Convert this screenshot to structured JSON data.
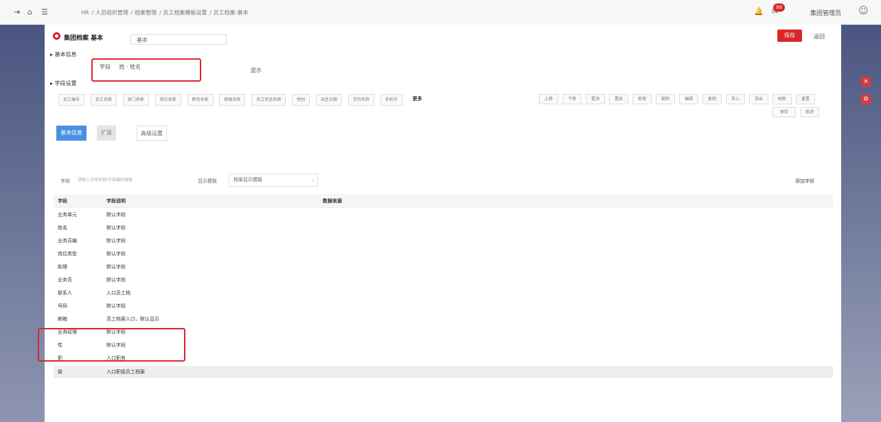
{
  "topbar": {
    "nav_icons": [
      "back-icon",
      "home-icon",
      "menu-icon"
    ],
    "breadcrumbs": [
      "HR",
      "人员组织管理",
      "档案管理",
      "员工档案模板设置",
      "员工档案-基本"
    ],
    "badge": "99",
    "user": "集团管理员",
    "colors": {
      "accent": "#d9262c",
      "primary": "#4a90e2"
    }
  },
  "header": {
    "title": "集团档案 基本",
    "select": "基本",
    "save_label": "保存",
    "back_label": "返回"
  },
  "section1": {
    "label": "基本信息",
    "field_label": "字段",
    "field_value": "姓 · 姓名",
    "right_label": "显示"
  },
  "section2": {
    "label": "字段设置",
    "chips": [
      "员工编号",
      "员工名称",
      "部门名称",
      "岗位名称",
      "职务名称",
      "职级名称",
      "员工状态名称",
      "性别",
      "出生日期",
      "学历名称",
      "手机号",
      "更多"
    ],
    "grid_buttons": [
      "上移",
      "下移",
      "置顶",
      "置底",
      "新增",
      "删除",
      "编辑",
      "复制",
      "导入",
      "导出",
      "刷新",
      "重置"
    ],
    "action1": "保存",
    "action2": "取消"
  },
  "tabs": [
    "基本信息",
    "扩展",
    "高级设置"
  ],
  "filter": {
    "label": "字段",
    "placeholder": "请输入字段名称/字段编码搜索",
    "label2": "显示模板",
    "select_value": "档案显示模板",
    "button": "添加字段"
  },
  "table": {
    "headers": [
      "字段",
      "字段说明",
      "数据来源"
    ],
    "rows": [
      [
        "业务单元",
        "默认字段"
      ],
      [
        "姓名",
        "默认字段"
      ],
      [
        "业务员编",
        "默认字段"
      ],
      [
        "岗位类型",
        "默认字段"
      ],
      [
        "助理",
        "默认字段"
      ],
      [
        "业务员",
        "默认字段"
      ],
      [
        "联系人",
        "入口员工档"
      ],
      [
        "号码",
        "默认字段"
      ],
      [
        "邮箱",
        "员工档案入口，默认显示"
      ],
      [
        "业务经理",
        "默认字段"
      ],
      [
        "性",
        "默认字段"
      ],
      [
        "职",
        "入口职务"
      ],
      [
        "级",
        "入口职级员工档案"
      ]
    ]
  }
}
